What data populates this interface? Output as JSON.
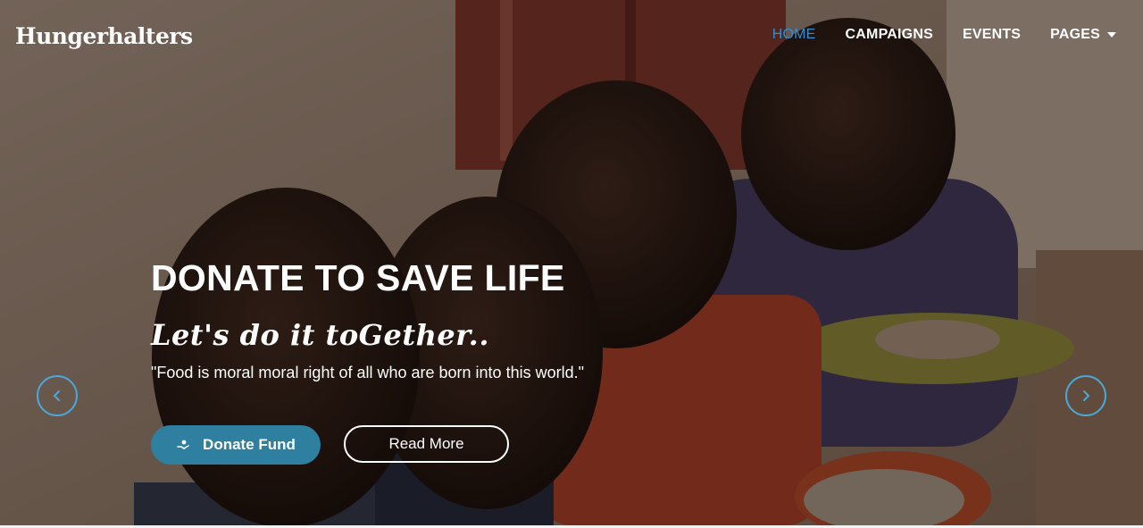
{
  "brand": {
    "name": "Hungerhalters"
  },
  "nav": {
    "items": [
      {
        "label": "HOME",
        "active": true
      },
      {
        "label": "CAMPAIGNS",
        "active": false
      },
      {
        "label": "EVENTS",
        "active": false
      },
      {
        "label": "PAGES",
        "active": false,
        "has_dropdown": true
      }
    ]
  },
  "hero": {
    "title": "DONATE TO SAVE LIFE",
    "subtitle": "Let's do it toGether..",
    "quote": "\"Food is moral moral right of all who are born into this world.\"",
    "donate_button": "Donate Fund",
    "read_more_button": "Read More"
  },
  "icons": {
    "donate": "donate-hand-icon",
    "prev": "chevron-left-icon",
    "next": "chevron-right-icon",
    "dropdown": "caret-down-icon"
  },
  "colors": {
    "accent": "#2f8fd6",
    "button": "#2f7fa0",
    "arrow_border": "#4aa8d8",
    "text": "#ffffff"
  }
}
